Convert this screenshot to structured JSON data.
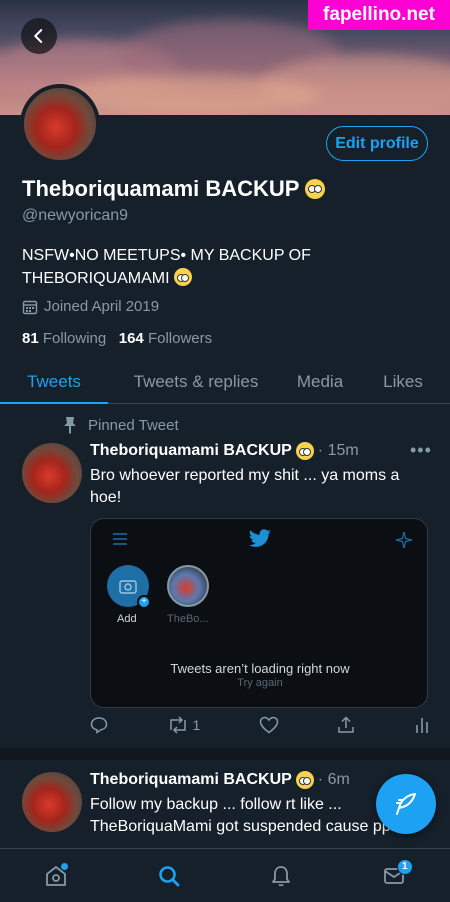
{
  "watermark": "fapellino.net",
  "profile": {
    "edit_label": "Edit profile",
    "display_name": "Theboriquamami BACKUP",
    "handle": "@newyorican9",
    "bio_line1": "NSFW•NO MEETUPS• MY BACKUP OF",
    "bio_line2": "THEBORIQUAMAMI",
    "joined": "Joined April 2019",
    "following_count": "81",
    "following_label": "Following",
    "followers_count": "164",
    "followers_label": "Followers"
  },
  "tabs": [
    {
      "label": "Tweets",
      "active": true
    },
    {
      "label": "Tweets & replies",
      "active": false
    },
    {
      "label": "Media",
      "active": false
    },
    {
      "label": "Likes",
      "active": false
    }
  ],
  "tweets": [
    {
      "pinned_label": "Pinned Tweet",
      "name": "Theboriquamami BACKUP",
      "time": "· 15m",
      "text": "Bro whoever reported my shit ... ya moms a hoe!",
      "embed": {
        "story_add_label": "Add",
        "story_user_label": "TheBo...",
        "message": "Tweets aren’t loading right now",
        "retry": "Try again"
      },
      "retweet_count": "1"
    },
    {
      "name": "Theboriquamami BACKUP",
      "time": "· 6m",
      "text_line1": "Follow my backup ... follow rt like ...",
      "text_line2": "TheBoriquaMami got suspended cause ppl"
    }
  ],
  "nav": {
    "messages_badge": "1"
  },
  "colors": {
    "accent": "#1da1f2",
    "background": "#15202b",
    "muted": "#8899a6"
  }
}
